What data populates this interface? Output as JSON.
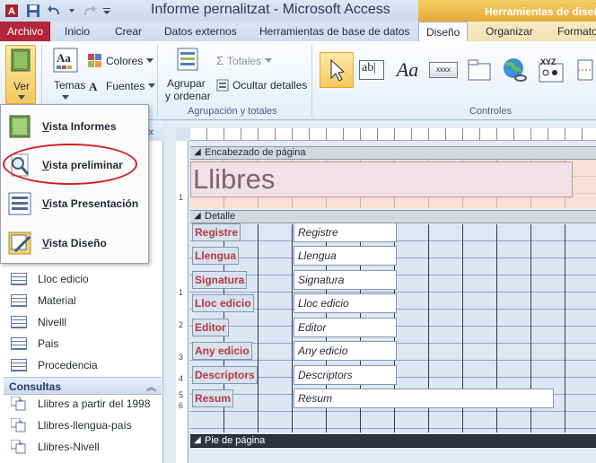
{
  "window": {
    "title": "Informe pernalitzat  -  Microsoft Access",
    "context_group": "Herramientas de diseño"
  },
  "tabs": {
    "archivo": "Archivo",
    "inicio": "Inicio",
    "crear": "Crear",
    "datos_externos": "Datos externos",
    "herramientas": "Herramientas de base de datos",
    "diseno": "Diseño",
    "organizar": "Organizar",
    "formato": "Formato"
  },
  "ribbon": {
    "ver": "Ver",
    "temas": "Temas",
    "colores": "Colores",
    "fuentes": "Fuentes",
    "agrupar_line1": "Agrupar",
    "agrupar_line2": "y ordenar",
    "totales": "Totales",
    "ocultar_detalles": "Ocultar detalles",
    "group_agrupacion": "Agrupación y totales",
    "group_controles": "Controles",
    "textbox_glyph": "ab|",
    "label_glyph": "Aa",
    "button_glyph": "xxxx",
    "xyz_glyph": "XYZ"
  },
  "view_menu": {
    "items": [
      {
        "accel": "V",
        "rest": "ista Informes"
      },
      {
        "accel": "V",
        "rest": "ista preliminar"
      },
      {
        "accel": "V",
        "rest": "ista Presentación"
      },
      {
        "accel": "V",
        "rest": "ista Diseño"
      }
    ]
  },
  "nav": {
    "tables": [
      "Lloc edicio",
      "Material",
      "Nivelll",
      "Pais",
      "Procedencia"
    ],
    "consultas_header": "Consultas",
    "queries": [
      "Llibres a partir del 1998",
      "Llibres-llengua-país",
      "Llibres-Nivell"
    ]
  },
  "designer": {
    "page_header_label": "Encabezado de página",
    "detail_label": "Detalle",
    "page_footer_label": "Pie de página",
    "report_title": "Llibres",
    "ruler_numbers": [
      "1",
      "1",
      "2",
      "3",
      "4",
      "5",
      "6"
    ],
    "fields": [
      {
        "label": "Registre",
        "control": "Registre"
      },
      {
        "label": "Llengua",
        "control": "Llengua"
      },
      {
        "label": "Signatura",
        "control": "Signatura"
      },
      {
        "label": "Lloc edicio",
        "control": "Lloc edicio"
      },
      {
        "label": "Editor",
        "control": "Editor"
      },
      {
        "label": "Any edicio",
        "control": "Any edicio"
      },
      {
        "label": "Descriptors",
        "control": "Descriptors"
      },
      {
        "label": "Resum",
        "control": "Resum"
      }
    ]
  },
  "colors": {
    "archivo_tab": "#b3263a",
    "context_group": "#e8a93a",
    "label_text": "#b33a44",
    "highlight_ellipse": "#d21f1f"
  }
}
